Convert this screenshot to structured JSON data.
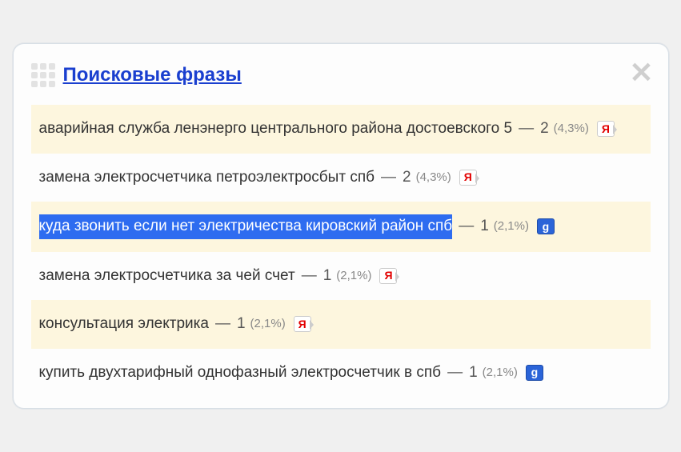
{
  "title": "Поисковые фразы",
  "rows": [
    {
      "phrase": "аварийная служба ленэнерго центрального района достоевского 5",
      "count": "2",
      "percent": "(4,3%)",
      "source": "yandex",
      "highlight": false
    },
    {
      "phrase": "замена электросчетчика петроэлектросбыт спб",
      "count": "2",
      "percent": "(4,3%)",
      "source": "yandex",
      "highlight": false
    },
    {
      "phrase": "куда звонить если нет электричества кировский район спб",
      "count": "1",
      "percent": "(2,1%)",
      "source": "google",
      "highlight": true
    },
    {
      "phrase": "замена электросчетчика за чей счет",
      "count": "1",
      "percent": "(2,1%)",
      "source": "yandex",
      "highlight": false
    },
    {
      "phrase": "консультация электрика",
      "count": "1",
      "percent": "(2,1%)",
      "source": "yandex",
      "highlight": false
    },
    {
      "phrase": "купить двухтарифный однофазный электросчетчик в спб",
      "count": "1",
      "percent": "(2,1%)",
      "source": "google",
      "highlight": false
    }
  ],
  "icons": {
    "yandex_glyph": "Я",
    "google_glyph": "g"
  }
}
